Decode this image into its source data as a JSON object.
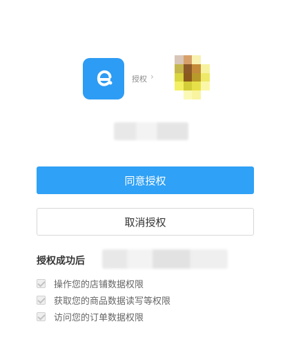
{
  "header": {
    "app_logo_letter": "e",
    "authorize_label": "授权",
    "arrow": "›",
    "app_color": "#2d9cf4"
  },
  "buttons": {
    "agree_label": "同意授权",
    "cancel_label": "取消授权",
    "agree_color": "#2fa1f6"
  },
  "permissions": {
    "title": "授权成功后",
    "items": [
      "操作您的店铺数据权限",
      "获取您的商品数据读写等权限",
      "访问您的订单数据权限"
    ]
  }
}
